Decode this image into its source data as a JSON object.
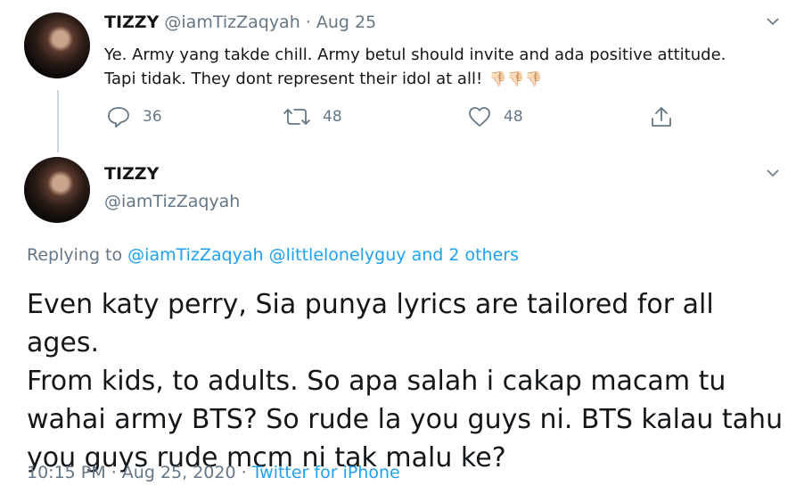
{
  "tweet1": {
    "display_name": "TIZZY",
    "handle": "@iamTizZaqyah",
    "separator": "·",
    "date": "Aug 25",
    "line1": "Ye. Army yang takde chill. Army betul should invite and ada positive attitude.",
    "line2": "Tapi tidak. They dont represent their idol at all!",
    "emoji": "👎🏻👎🏻👎🏻",
    "replies": "36",
    "retweets": "48",
    "likes": "48"
  },
  "tweet2": {
    "display_name": "TIZZY",
    "handle": "@iamTizZaqyah",
    "replying_prefix": "Replying to",
    "replying_user1": "@iamTizZaqyah",
    "replying_user2": "@littlelonelyguy",
    "replying_connector": "and",
    "replying_others": "2 others",
    "text_line1": "Even katy perry, Sia punya lyrics are tailored for all ages.",
    "text_line2": "From kids, to adults. So apa salah i cakap macam tu",
    "text_line3": "wahai army BTS? So rude la you guys ni. BTS kalau tahu",
    "text_line4": "you guys rude mcm ni tak malu ke?",
    "time": "10:15 PM",
    "dot1": "·",
    "full_date": "Aug 25, 2020",
    "dot2": "·",
    "source": "Twitter for iPhone"
  },
  "colors": {
    "link": "#1da1f2",
    "muted": "#657786",
    "text": "#14171a"
  },
  "icons": [
    "reply-icon",
    "retweet-icon",
    "like-icon",
    "share-icon",
    "chevron-down-icon"
  ]
}
